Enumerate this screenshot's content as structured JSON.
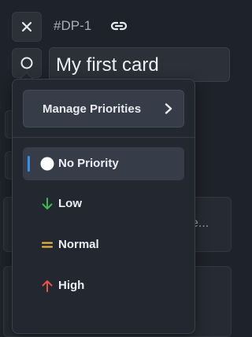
{
  "header": {
    "close_icon": "close-icon",
    "card_id": "#DP-1",
    "link_icon": "link-icon"
  },
  "card": {
    "status_icon": "circle-icon",
    "title": "My first card"
  },
  "background": {
    "truncated_text": "e..."
  },
  "priority_menu": {
    "manage_label": "Manage Priorities",
    "items": [
      {
        "label": "No Priority",
        "icon": "white-circle-icon",
        "selected": true
      },
      {
        "label": "Low",
        "icon": "arrow-down-icon",
        "color": "#3fb950"
      },
      {
        "label": "Normal",
        "icon": "equals-icon",
        "color": "#e3b341"
      },
      {
        "label": "High",
        "icon": "arrow-up-icon",
        "color": "#e5534b"
      }
    ]
  },
  "colors": {
    "background": "#1e222a",
    "accent": "#3b8fe4"
  }
}
